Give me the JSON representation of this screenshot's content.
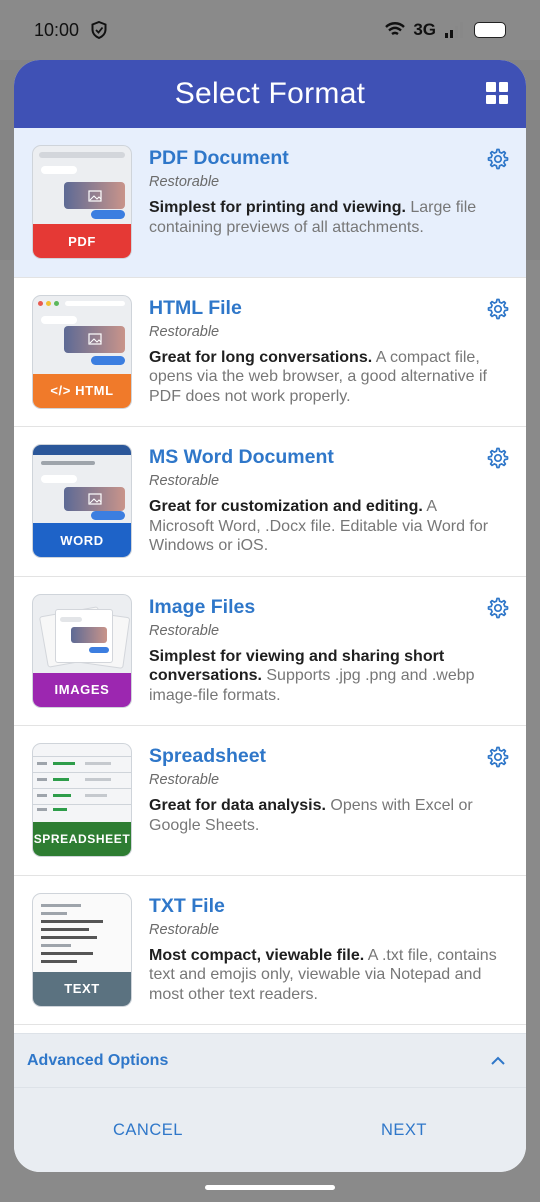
{
  "status_bar": {
    "time": "10:00",
    "network": "3G"
  },
  "dialog": {
    "title": "Select Format",
    "formats": [
      {
        "title": "PDF Document",
        "subtitle": "Restorable",
        "desc_bold": "Simplest for printing and viewing.",
        "desc_rest": " Large file containing previews of all attachments.",
        "band_label": "PDF",
        "band_color": "#e53935",
        "selected": true
      },
      {
        "title": "HTML File",
        "subtitle": "Restorable",
        "desc_bold": "Great for long conversations.",
        "desc_rest": " A compact file, opens via the web browser, a good alternative if PDF does not work properly.",
        "band_label": "</> HTML",
        "band_color": "#f07a2a"
      },
      {
        "title": "MS Word Document",
        "subtitle": "Restorable",
        "desc_bold": "Great for customization and editing.",
        "desc_rest": " A Microsoft Word, .Docx file. Editable via Word for Windows or iOS.",
        "band_label": "WORD",
        "band_color": "#1e63c8"
      },
      {
        "title": "Image Files",
        "subtitle": "Restorable",
        "desc_bold": "Simplest for viewing and sharing short conversations.",
        "desc_rest": " Supports .jpg .png and .webp image-file formats.",
        "band_label": "IMAGES",
        "band_color": "#9c27b0"
      },
      {
        "title": "Spreadsheet",
        "subtitle": "Restorable",
        "desc_bold": "Great for data analysis.",
        "desc_rest": " Opens with Excel or Google Sheets.",
        "band_label": "SPREADSHEET",
        "band_color": "#2e7d32"
      },
      {
        "title": "TXT File",
        "subtitle": "Restorable",
        "desc_bold": "Most compact, viewable file.",
        "desc_rest": " A .txt file, contains text and emojis only, viewable via Notepad and most other text readers.",
        "band_label": "TEXT",
        "band_color": "#5b7280"
      }
    ],
    "advanced_label": "Advanced Options",
    "cancel_label": "CANCEL",
    "next_label": "NEXT"
  },
  "colors": {
    "header": "#3f51b5",
    "accent": "#2f77c9",
    "selected_row": "#e7effc"
  }
}
